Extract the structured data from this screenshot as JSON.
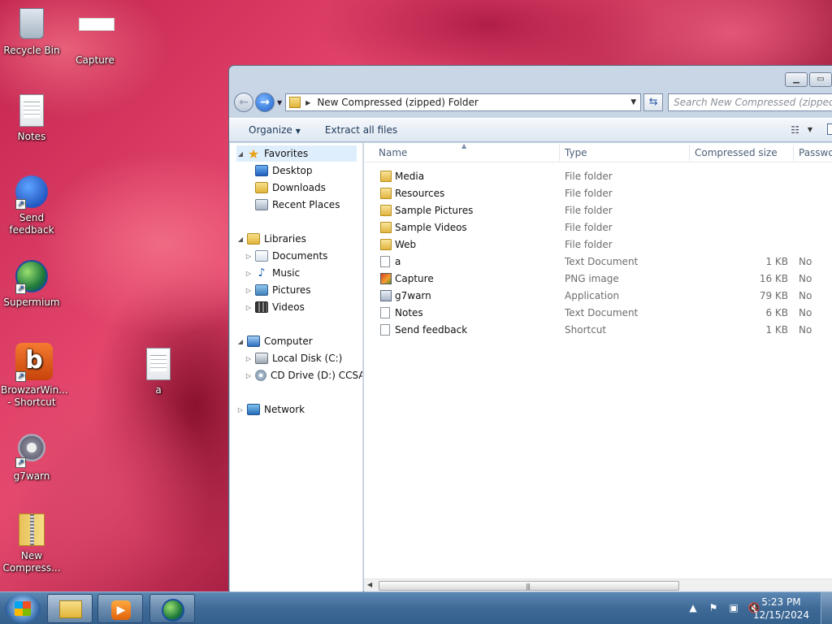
{
  "desktop": {
    "icons": [
      {
        "label": "Recycle Bin",
        "icon": "recycle-bin-icon"
      },
      {
        "label": "Capture",
        "icon": "image-file-icon"
      },
      {
        "label": "Notes",
        "icon": "text-file-icon"
      },
      {
        "label": "Send feedback",
        "icon": "feedback-icon"
      },
      {
        "label": "Supermium",
        "icon": "browser-globe-icon"
      },
      {
        "label": "BrowzarWin... - Shortcut",
        "icon": "browzar-icon"
      },
      {
        "label": "a",
        "icon": "text-file-icon"
      },
      {
        "label": "g7warn",
        "icon": "gear-app-icon"
      },
      {
        "label": "New Compress...",
        "icon": "zip-folder-icon"
      }
    ]
  },
  "window": {
    "caption_minimize": "▭",
    "caption_restore": "▭",
    "address": "New Compressed (zipped) Folder",
    "search_placeholder": "Search New Compressed (zipped) Fo",
    "commands": {
      "organize": "Organize",
      "extract": "Extract all files"
    },
    "nav": {
      "favorites": "Favorites",
      "favorites_items": [
        "Desktop",
        "Downloads",
        "Recent Places"
      ],
      "libraries": "Libraries",
      "libraries_items": [
        "Documents",
        "Music",
        "Pictures",
        "Videos"
      ],
      "computer": "Computer",
      "computer_items": [
        "Local Disk (C:)",
        "CD Drive (D:) CCSA_"
      ],
      "network": "Network"
    },
    "columns": {
      "name": "Name",
      "type": "Type",
      "compressed_size": "Compressed size",
      "password": "Passwo"
    },
    "files": [
      {
        "name": "Media",
        "type": "File folder",
        "size": "",
        "password": "",
        "icon": "folder-icon"
      },
      {
        "name": "Resources",
        "type": "File folder",
        "size": "",
        "password": "",
        "icon": "folder-icon"
      },
      {
        "name": "Sample Pictures",
        "type": "File folder",
        "size": "",
        "password": "",
        "icon": "folder-icon"
      },
      {
        "name": "Sample Videos",
        "type": "File folder",
        "size": "",
        "password": "",
        "icon": "folder-icon"
      },
      {
        "name": "Web",
        "type": "File folder",
        "size": "",
        "password": "",
        "icon": "folder-icon"
      },
      {
        "name": "a",
        "type": "Text Document",
        "size": "1 KB",
        "password": "No",
        "icon": "text-document-icon"
      },
      {
        "name": "Capture",
        "type": "PNG image",
        "size": "16 KB",
        "password": "No",
        "icon": "png-image-icon"
      },
      {
        "name": "g7warn",
        "type": "Application",
        "size": "79 KB",
        "password": "No",
        "icon": "application-icon"
      },
      {
        "name": "Notes",
        "type": "Text Document",
        "size": "6 KB",
        "password": "No",
        "icon": "text-document-icon"
      },
      {
        "name": "Send feedback",
        "type": "Shortcut",
        "size": "1 KB",
        "password": "No",
        "icon": "shortcut-icon"
      }
    ]
  },
  "taskbar": {
    "time": "5:23 PM",
    "date": "12/15/2024"
  }
}
